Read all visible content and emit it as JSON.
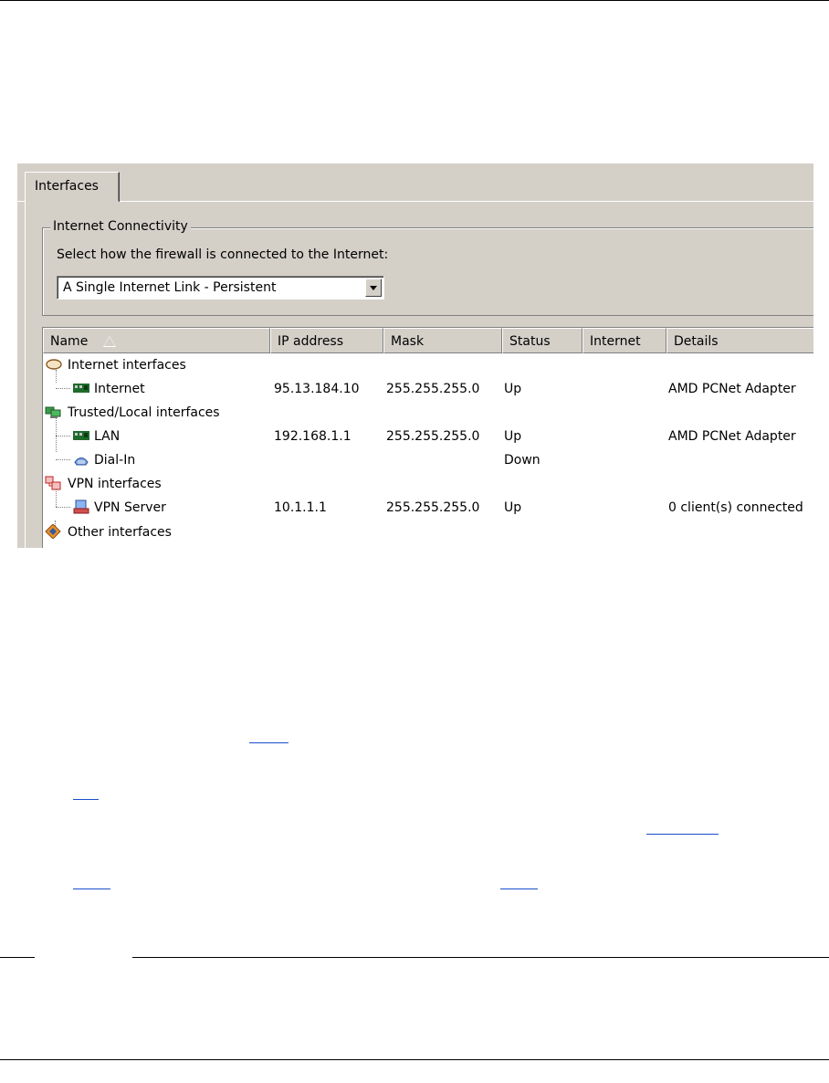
{
  "tabs": [
    {
      "label": "Interfaces"
    }
  ],
  "connectivity": {
    "group_label": "Internet Connectivity",
    "prompt": "Select how the firewall is connected to the Internet:",
    "mode_value": "A Single Internet Link - Persistent"
  },
  "columns": [
    "Name",
    "IP address",
    "Mask",
    "Status",
    "Internet",
    "Details"
  ],
  "groups": {
    "internet": "Internet interfaces",
    "trusted": "Trusted/Local interfaces",
    "vpn": "VPN interfaces",
    "other": "Other interfaces"
  },
  "rows": {
    "internet": {
      "name": "Internet",
      "ip": "95.13.184.10",
      "mask": "255.255.255.0",
      "status": "Up",
      "details": "AMD PCNet Adapter"
    },
    "lan": {
      "name": "LAN",
      "ip": "192.168.1.1",
      "mask": "255.255.255.0",
      "status": "Up",
      "details": "AMD PCNet Adapter"
    },
    "dialin": {
      "name": "Dial-In",
      "status": "Down"
    },
    "vpnserver": {
      "name": "VPN Server",
      "ip": "10.1.1.1",
      "mask": "255.255.255.0",
      "status": "Up",
      "details": "0 client(s) connected"
    }
  },
  "colors": {
    "window_bg": "#d4d0c8",
    "link": "#1a4fcc"
  }
}
